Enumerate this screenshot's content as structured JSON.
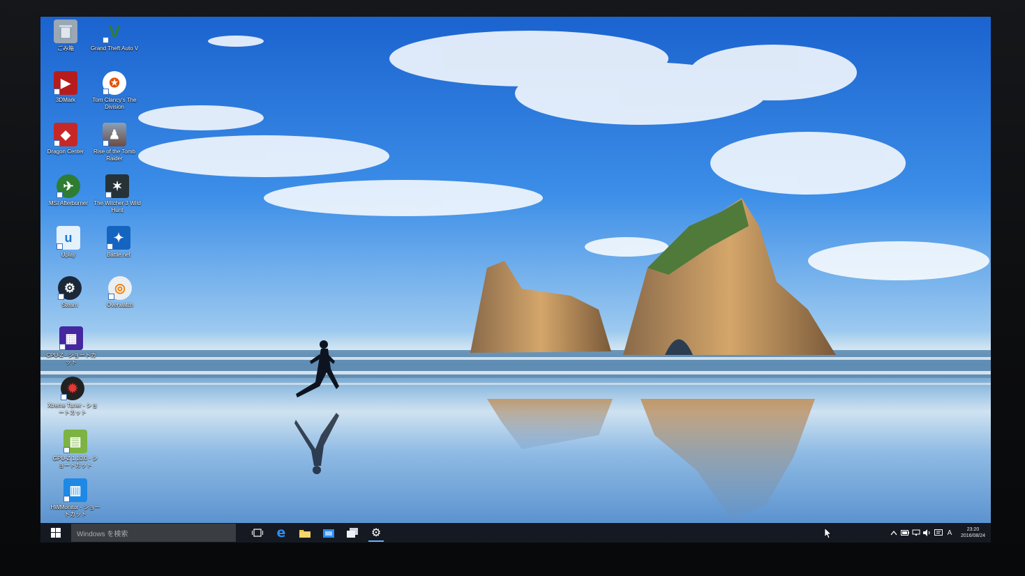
{
  "desktop": {
    "icons": [
      {
        "label": "ごみ箱",
        "icon": "recycle-bin-icon",
        "color": "#9aa7b4"
      },
      {
        "label": "Grand Theft Auto V",
        "icon": "gta-v-icon",
        "color": "#2e7d32"
      },
      {
        "label": "3DMark",
        "icon": "3dmark-icon",
        "color": "#c62828"
      },
      {
        "label": "Tom Clancy's The Division",
        "icon": "division-icon",
        "color": "#e65100"
      },
      {
        "label": "Dragon Center",
        "icon": "dragon-center-icon",
        "color": "#b71c1c"
      },
      {
        "label": "Rise of the Tomb Raider",
        "icon": "tomb-raider-icon",
        "color": "#6d4c41"
      },
      {
        "label": "MSI Afterburner",
        "icon": "msi-afterburner-icon",
        "color": "#2e7d32"
      },
      {
        "label": "The Witcher 3 Wild Hunt",
        "icon": "witcher-icon",
        "color": "#37474f"
      },
      {
        "label": "Uplay",
        "icon": "uplay-icon",
        "color": "#e3f2fd"
      },
      {
        "label": "Battle.net",
        "icon": "battlenet-icon",
        "color": "#1565c0"
      },
      {
        "label": "Steam",
        "icon": "steam-icon",
        "color": "#1b2838"
      },
      {
        "label": "Overwatch",
        "icon": "overwatch-icon",
        "color": "#f57c00"
      },
      {
        "label": "CPU-Z - ショートカット",
        "icon": "cpuz-icon",
        "color": "#4527a0"
      },
      {
        "label": "Xtreme Tuner - ショートカット",
        "icon": "tuner-icon",
        "color": "#b71c1c"
      },
      {
        "label": "GPU-Z 1.10.0 - ショートカット",
        "icon": "gpuz-icon",
        "color": "#558b2f"
      },
      {
        "label": "HWMonitor - ショートカット",
        "icon": "hwmonitor-icon",
        "color": "#1565c0"
      }
    ]
  },
  "taskbar": {
    "search_placeholder": "Windows を検索",
    "ime_label": "A",
    "clock_time": "23:20",
    "clock_date": "2016/08/24"
  }
}
